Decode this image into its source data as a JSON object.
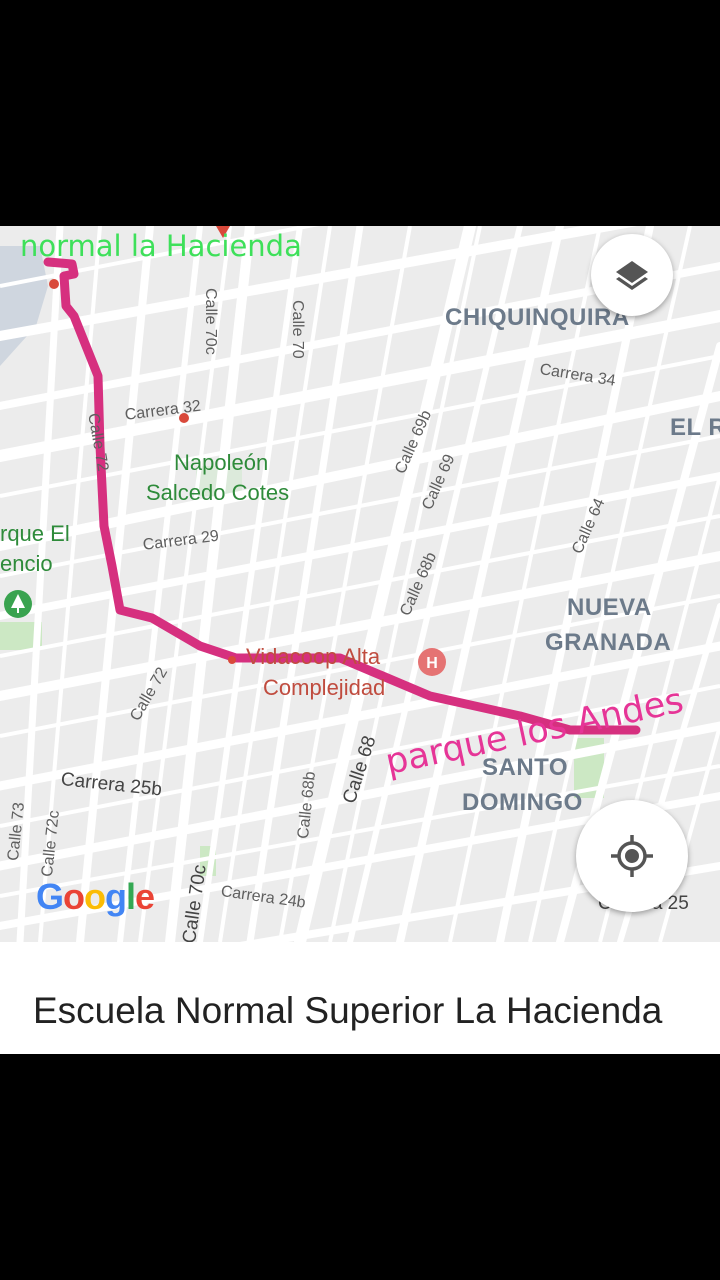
{
  "map": {
    "annotations": {
      "start": "normal la Hacienda",
      "end": "parque los Andes"
    },
    "neighborhoods": [
      "CHIQUINQUIRA",
      "EL R",
      "NUEVA",
      "GRANADA",
      "SANTO",
      "DOMINGO"
    ],
    "parks": [
      "Napoleón",
      "Salcedo Cotes",
      "rque El",
      "encio"
    ],
    "pois": [
      "Vidacoop Alta",
      "Complejidad"
    ],
    "streets": {
      "calle_70c_top": "Calle 70c",
      "calle_70_top": "Calle 70",
      "carrera_34": "Carrera 34",
      "carrera_32": "Carrera 32",
      "calle_72_top": "Calle 72",
      "calle_69b": "Calle 69b",
      "calle_69": "Calle 69",
      "calle_64": "Calle 64",
      "carrera_29": "Carrera 29",
      "calle_68b_mid": "Calle 68b",
      "calle_72_mid": "Calle 72",
      "calle_68": "Calle 68",
      "carrera_25b": "Carrera 25b",
      "calle_68b_low": "Calle 68b",
      "calle_73": "Calle 73",
      "calle_72c": "Calle 72c",
      "calle_70c_low": "Calle 70c",
      "carrera_24b": "Carrera 24b",
      "carrera_25": "Carrera 25"
    },
    "controls": {
      "layers_icon": "layers-icon",
      "locate_icon": "my-location-icon"
    },
    "logo": [
      "G",
      "o",
      "o",
      "g",
      "l",
      "e"
    ],
    "colors": {
      "route": "#d6307f",
      "start_annotation": "#3ee05a",
      "end_annotation": "#e63597",
      "park_label": "#2e8b3a",
      "poi_label": "#c04c3f",
      "neighborhood_label": "#6c7a8a"
    }
  },
  "panel": {
    "title": "Escuela Normal Superior La Hacienda"
  }
}
